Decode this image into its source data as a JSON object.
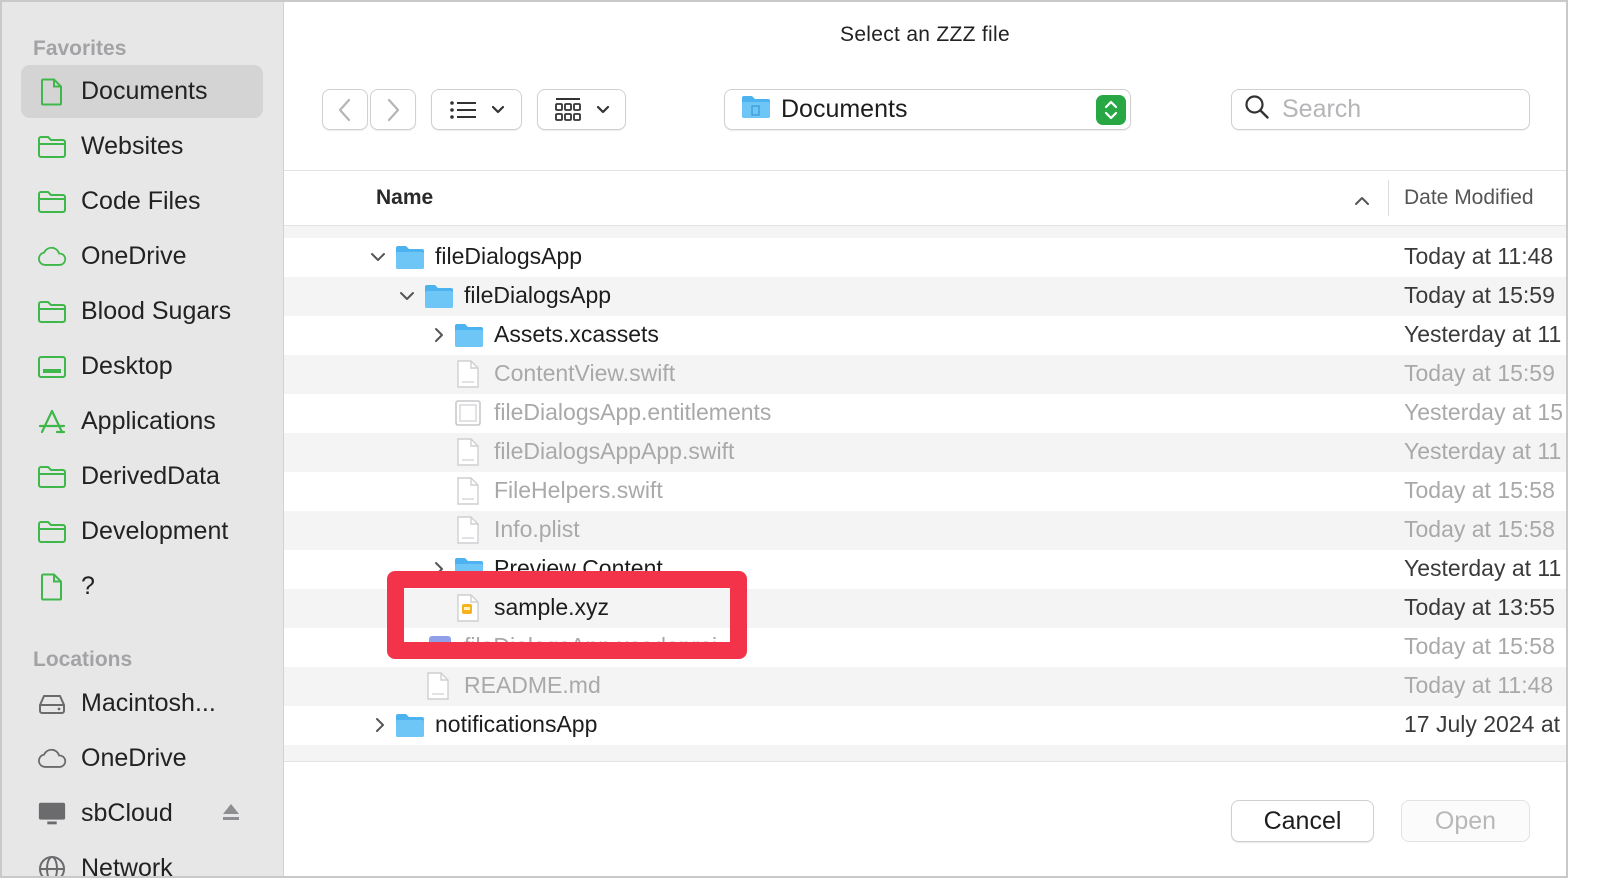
{
  "window": {
    "title": "Select an ZZZ file"
  },
  "sidebar": {
    "favorites_label": "Favorites",
    "locations_label": "Locations",
    "favorites": [
      {
        "label": "Documents",
        "icon": "document-icon",
        "selected": true
      },
      {
        "label": "Websites",
        "icon": "folder-icon"
      },
      {
        "label": "Code Files",
        "icon": "folder-icon"
      },
      {
        "label": "OneDrive",
        "icon": "cloud-icon"
      },
      {
        "label": "Blood Sugars",
        "icon": "folder-icon"
      },
      {
        "label": "Desktop",
        "icon": "desktop-icon"
      },
      {
        "label": "Applications",
        "icon": "applications-icon"
      },
      {
        "label": "DerivedData",
        "icon": "folder-icon"
      },
      {
        "label": "Development",
        "icon": "folder-icon"
      },
      {
        "label": "?",
        "icon": "document-icon"
      }
    ],
    "locations": [
      {
        "label": "Macintosh...",
        "icon": "hard-drive-icon"
      },
      {
        "label": "OneDrive",
        "icon": "cloud-icon"
      },
      {
        "label": "sbCloud",
        "icon": "display-icon",
        "eject": true
      },
      {
        "label": "Network",
        "icon": "globe-icon"
      }
    ]
  },
  "toolbar": {
    "back_icon": "chevron-left-icon",
    "forward_icon": "chevron-right-icon",
    "list_view_icon": "list-view-icon",
    "grid_view_icon": "grid-view-icon",
    "path": "Documents",
    "search_placeholder": "Search"
  },
  "list": {
    "headers": {
      "name": "Name",
      "date": "Date Modified"
    },
    "rows": [
      {
        "name": "fileDialogsApp",
        "date": "Today at 11:48",
        "type": "folder",
        "expanded": true,
        "level": 0,
        "dim": false
      },
      {
        "name": "fileDialogsApp",
        "date": "Today at 15:59",
        "type": "folder",
        "expanded": true,
        "level": 1,
        "dim": false
      },
      {
        "name": "Assets.xcassets",
        "date": "Yesterday at 11",
        "type": "folder",
        "expanded": false,
        "level": 2,
        "dim": false
      },
      {
        "name": "ContentView.swift",
        "date": "Today at 15:59",
        "type": "swift",
        "level": 2,
        "dim": true
      },
      {
        "name": "fileDialogsApp.entitlements",
        "date": "Yesterday at 15",
        "type": "entitlements",
        "level": 2,
        "dim": true
      },
      {
        "name": "fileDialogsAppApp.swift",
        "date": "Yesterday at 11",
        "type": "swift",
        "level": 2,
        "dim": true
      },
      {
        "name": "FileHelpers.swift",
        "date": "Today at 15:58",
        "type": "swift",
        "level": 2,
        "dim": true
      },
      {
        "name": "Info.plist",
        "date": "Today at 15:58",
        "type": "plist",
        "level": 2,
        "dim": true
      },
      {
        "name": "Preview Content",
        "date": "Yesterday at 11",
        "type": "folder",
        "expanded": false,
        "level": 2,
        "dim": false
      },
      {
        "name": "sample.xyz",
        "date": "Today at 13:55",
        "type": "xyz",
        "level": 2,
        "dim": false
      },
      {
        "name": "fileDialogsApp.xcodeproj",
        "date": "Today at 15:58",
        "type": "xcodeproj",
        "level": 1,
        "dim": true
      },
      {
        "name": "README.md",
        "date": "Today at 11:48",
        "type": "md",
        "level": 1,
        "dim": true
      },
      {
        "name": "notificationsApp",
        "date": "17 July 2024 at",
        "type": "folder",
        "expanded": false,
        "level": 0,
        "dim": false
      }
    ]
  },
  "buttons": {
    "cancel": "Cancel",
    "open": "Open"
  },
  "colors": {
    "accent_green": "#28a745",
    "folder_blue": "#4cb3f0",
    "sidebar_green": "#3fb74a",
    "highlight_red": "#f3334a"
  }
}
